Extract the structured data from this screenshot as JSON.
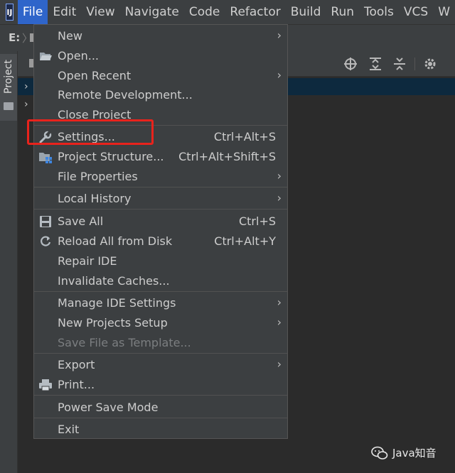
{
  "menubar": {
    "logo_text": "IJ",
    "items": [
      "File",
      "Edit",
      "View",
      "Navigate",
      "Code",
      "Refactor",
      "Build",
      "Run",
      "Tools",
      "VCS",
      "W"
    ]
  },
  "navbar": {
    "drive": "E:"
  },
  "tool_strip": {
    "project_tab": "Project"
  },
  "file_menu": {
    "items": [
      {
        "label": "New",
        "shortcut": "",
        "submenu": true,
        "icon": ""
      },
      {
        "label": "Open...",
        "shortcut": "",
        "submenu": false,
        "icon": "folder-open-icon"
      },
      {
        "label": "Open Recent",
        "shortcut": "",
        "submenu": true,
        "icon": ""
      },
      {
        "label": "Remote Development...",
        "shortcut": "",
        "submenu": false,
        "icon": ""
      },
      {
        "label": "Close Project",
        "shortcut": "",
        "submenu": false,
        "icon": ""
      },
      {
        "label": "Settings...",
        "shortcut": "Ctrl+Alt+S",
        "submenu": false,
        "icon": "wrench-icon"
      },
      {
        "label": "Project Structure...",
        "shortcut": "Ctrl+Alt+Shift+S",
        "submenu": false,
        "icon": "project-structure-icon"
      },
      {
        "label": "File Properties",
        "shortcut": "",
        "submenu": true,
        "icon": ""
      },
      {
        "label": "Local History",
        "shortcut": "",
        "submenu": true,
        "icon": ""
      },
      {
        "label": "Save All",
        "shortcut": "Ctrl+S",
        "submenu": false,
        "icon": "save-icon"
      },
      {
        "label": "Reload All from Disk",
        "shortcut": "Ctrl+Alt+Y",
        "submenu": false,
        "icon": "reload-icon"
      },
      {
        "label": "Repair IDE",
        "shortcut": "",
        "submenu": false,
        "icon": ""
      },
      {
        "label": "Invalidate Caches...",
        "shortcut": "",
        "submenu": false,
        "icon": ""
      },
      {
        "label": "Manage IDE Settings",
        "shortcut": "",
        "submenu": true,
        "icon": ""
      },
      {
        "label": "New Projects Setup",
        "shortcut": "",
        "submenu": true,
        "icon": ""
      },
      {
        "label": "Save File as Template...",
        "shortcut": "",
        "submenu": false,
        "icon": "",
        "disabled": true
      },
      {
        "label": "Export",
        "shortcut": "",
        "submenu": true,
        "icon": ""
      },
      {
        "label": "Print...",
        "shortcut": "",
        "submenu": false,
        "icon": "print-icon"
      },
      {
        "label": "Power Save Mode",
        "shortcut": "",
        "submenu": false,
        "icon": ""
      },
      {
        "label": "Exit",
        "shortcut": "",
        "submenu": false,
        "icon": ""
      }
    ],
    "highlighted_item": "Settings..."
  },
  "watermark": {
    "text": "Java知音"
  },
  "colors": {
    "menubar_bg": "#3c3f41",
    "editor_bg": "#2b2b2b",
    "active_menu": "#2f65ca",
    "highlight_box": "#e8231c",
    "selected_row": "#0d293e"
  }
}
